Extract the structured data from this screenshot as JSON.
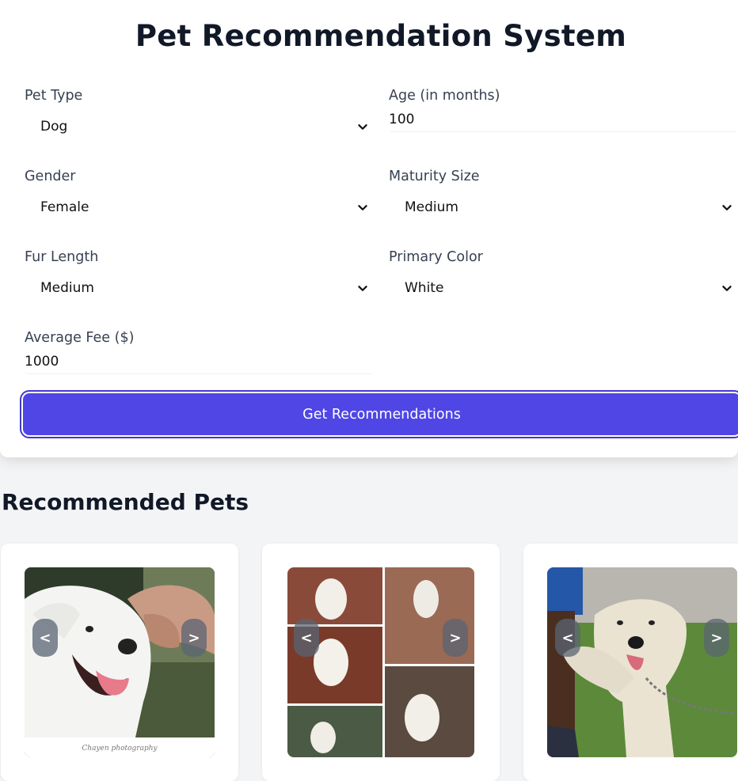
{
  "app": {
    "title": "Pet Recommendation System"
  },
  "form": {
    "pet_type": {
      "label": "Pet Type",
      "value": "Dog"
    },
    "age": {
      "label": "Age (in months)",
      "value": "100"
    },
    "gender": {
      "label": "Gender",
      "value": "Female"
    },
    "maturity_size": {
      "label": "Maturity Size",
      "value": "Medium"
    },
    "fur_length": {
      "label": "Fur Length",
      "value": "Medium"
    },
    "primary_color": {
      "label": "Primary Color",
      "value": "White"
    },
    "average_fee": {
      "label": "Average Fee ($)",
      "value": "1000"
    },
    "submit_label": "Get Recommendations"
  },
  "results": {
    "title": "Recommended Pets",
    "cards": [
      {
        "prev_label": "<",
        "next_label": ">",
        "watermark": "Chayen photography"
      },
      {
        "prev_label": "<",
        "next_label": ">"
      },
      {
        "prev_label": "<",
        "next_label": ">"
      }
    ]
  },
  "icons": {
    "dropdown": "chevron-down-icon"
  },
  "colors": {
    "accent": "#4f46e5",
    "background": "#f3f4f6",
    "card": "#ffffff"
  }
}
